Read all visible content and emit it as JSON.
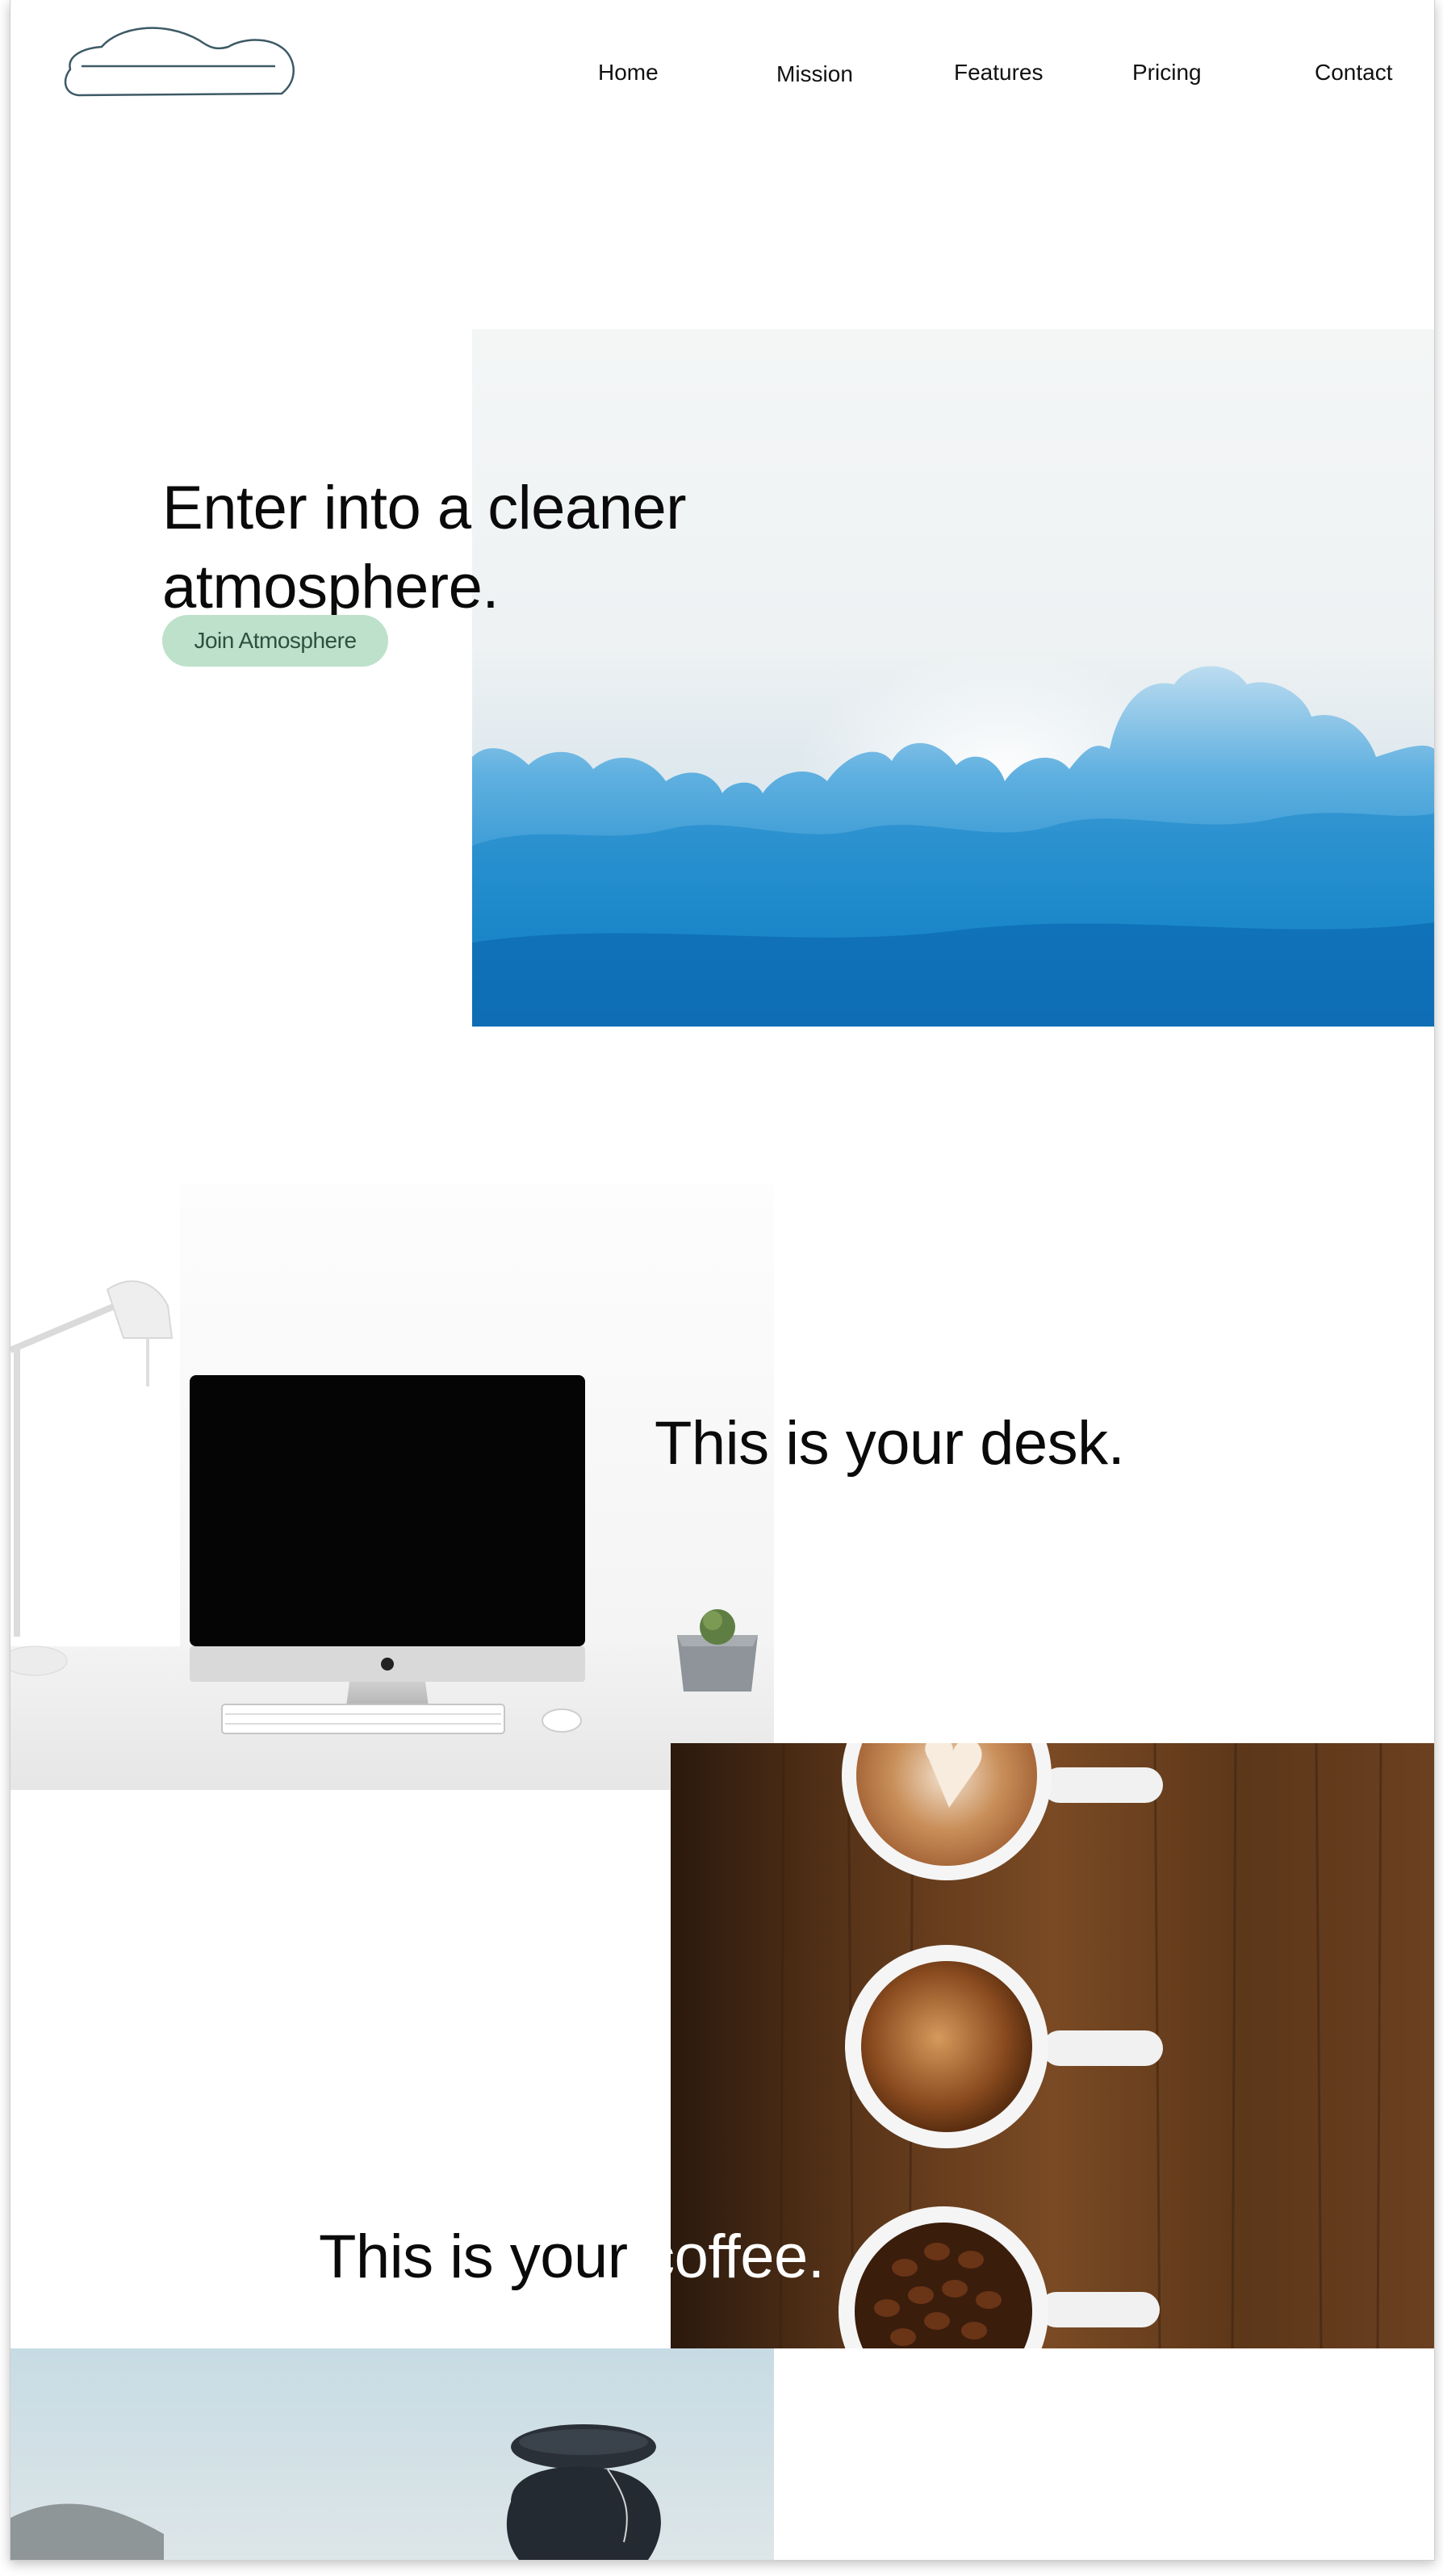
{
  "nav": {
    "items": [
      {
        "label": "Home"
      },
      {
        "label": "Mission"
      },
      {
        "label": "Features"
      },
      {
        "label": "Pricing"
      },
      {
        "label": "Contact"
      }
    ]
  },
  "hero": {
    "title": "Enter into a cleaner atmosphere.",
    "cta_label": "Join Atmosphere"
  },
  "desk": {
    "title": "This is your desk."
  },
  "coffee": {
    "title_part_1": "This is your ",
    "title_part_2": "coffee."
  },
  "colors": {
    "cta_background": "#bde1ca",
    "logo_stroke": "#3d5a66",
    "sky_blue": "#1a87c9"
  },
  "icons": {
    "logo": "cloud-outline-logo"
  }
}
